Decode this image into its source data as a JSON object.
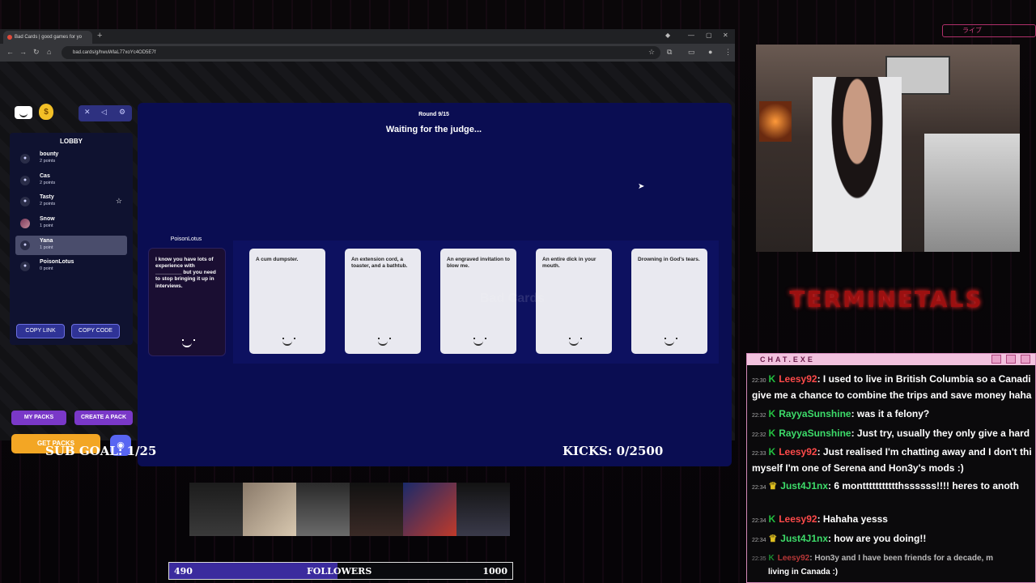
{
  "browser": {
    "tab_title": "Bad Cards | good games for yo",
    "url": "bad.cards/g/hwuWlaL77xoYc4OD5E7f"
  },
  "lobby": {
    "title": "LOBBY",
    "players": [
      {
        "name": "bounty",
        "points": "2 points",
        "host": false,
        "selected": false
      },
      {
        "name": "Cas",
        "points": "2 points",
        "host": false,
        "selected": false
      },
      {
        "name": "Tasty",
        "points": "2 points",
        "host": true,
        "selected": false
      },
      {
        "name": "Snow",
        "points": "1 point",
        "host": false,
        "selected": false
      },
      {
        "name": "Yana",
        "points": "1 point",
        "host": false,
        "selected": true
      },
      {
        "name": "PoisonLotus",
        "points": "0 point",
        "host": false,
        "selected": false
      }
    ],
    "copy_link": "COPY LINK",
    "copy_code": "COPY CODE"
  },
  "packs": {
    "my_packs": "MY PACKS",
    "create_pack": "CREATE A PACK",
    "get_packs": "GET PACKS"
  },
  "game": {
    "round": "Round 9/15",
    "status": "Waiting for the judge...",
    "black_card_owner": "PoisonLotus",
    "black_card_text": "I know you have lots of experience with _________ but you need to stop bringing it up in interviews.",
    "watermark": "Bad Cards",
    "white_cards": [
      "A cum dumpster.",
      "An extension cord, a toaster, and a bathtub.",
      "An engraved invitation to blow me.",
      "An entire dick in your mouth.",
      "Drowning in God's tears."
    ]
  },
  "overlay": {
    "sub_goal": "SUB GOAL: 1/25",
    "kicks": "KICKS: 0/2500",
    "followers_label": "FOLLOWERS",
    "followers_current": "490",
    "followers_target": "1000",
    "followers_progress": 0.49,
    "brand": "TERMINETALS",
    "top_deco": "ライブ"
  },
  "chat": {
    "title": "CHAT.EXE",
    "messages": [
      {
        "time": "22:30",
        "user": "Leesy92",
        "color": "#ff4a4a",
        "badge": "K",
        "text": ": I used to live in British Columbia so a Canadi",
        "cont": "give me a chance to combine the trips and save money haha"
      },
      {
        "time": "22:32",
        "user": "RayyaSunshine",
        "color": "#3ddc6a",
        "badge": "K",
        "text": ": was it a felony?"
      },
      {
        "time": "22:32",
        "user": "RayyaSunshine",
        "color": "#3ddc6a",
        "badge": "K",
        "text": ": Just try, usually they only give a hard"
      },
      {
        "time": "22:33",
        "user": "Leesy92",
        "color": "#ff4a4a",
        "badge": "K",
        "text": ": Just realised I'm chatting away and I don't thi",
        "cont": "myself  I'm one of Serena and Hon3y's mods :)"
      },
      {
        "time": "22:34",
        "user": "Just4J1nx",
        "color": "#3ddc6a",
        "badge": "♛",
        "text": ": 6 monttttttttttthssssss!!!! heres to anoth"
      },
      {
        "time": "22:34",
        "user": "Leesy92",
        "color": "#ff4a4a",
        "badge": "K",
        "text": ": Hahaha yesss"
      },
      {
        "time": "22:34",
        "user": "Just4J1nx",
        "color": "#3ddc6a",
        "badge": "♛",
        "text": ": how are you doing!!"
      },
      {
        "time": "22:35",
        "user": "Leesy92",
        "color": "#ff4a4a",
        "badge": "K",
        "text": ": Hon3y and I have been friends for a decade, m",
        "cont": "living in Canada :)"
      }
    ]
  }
}
